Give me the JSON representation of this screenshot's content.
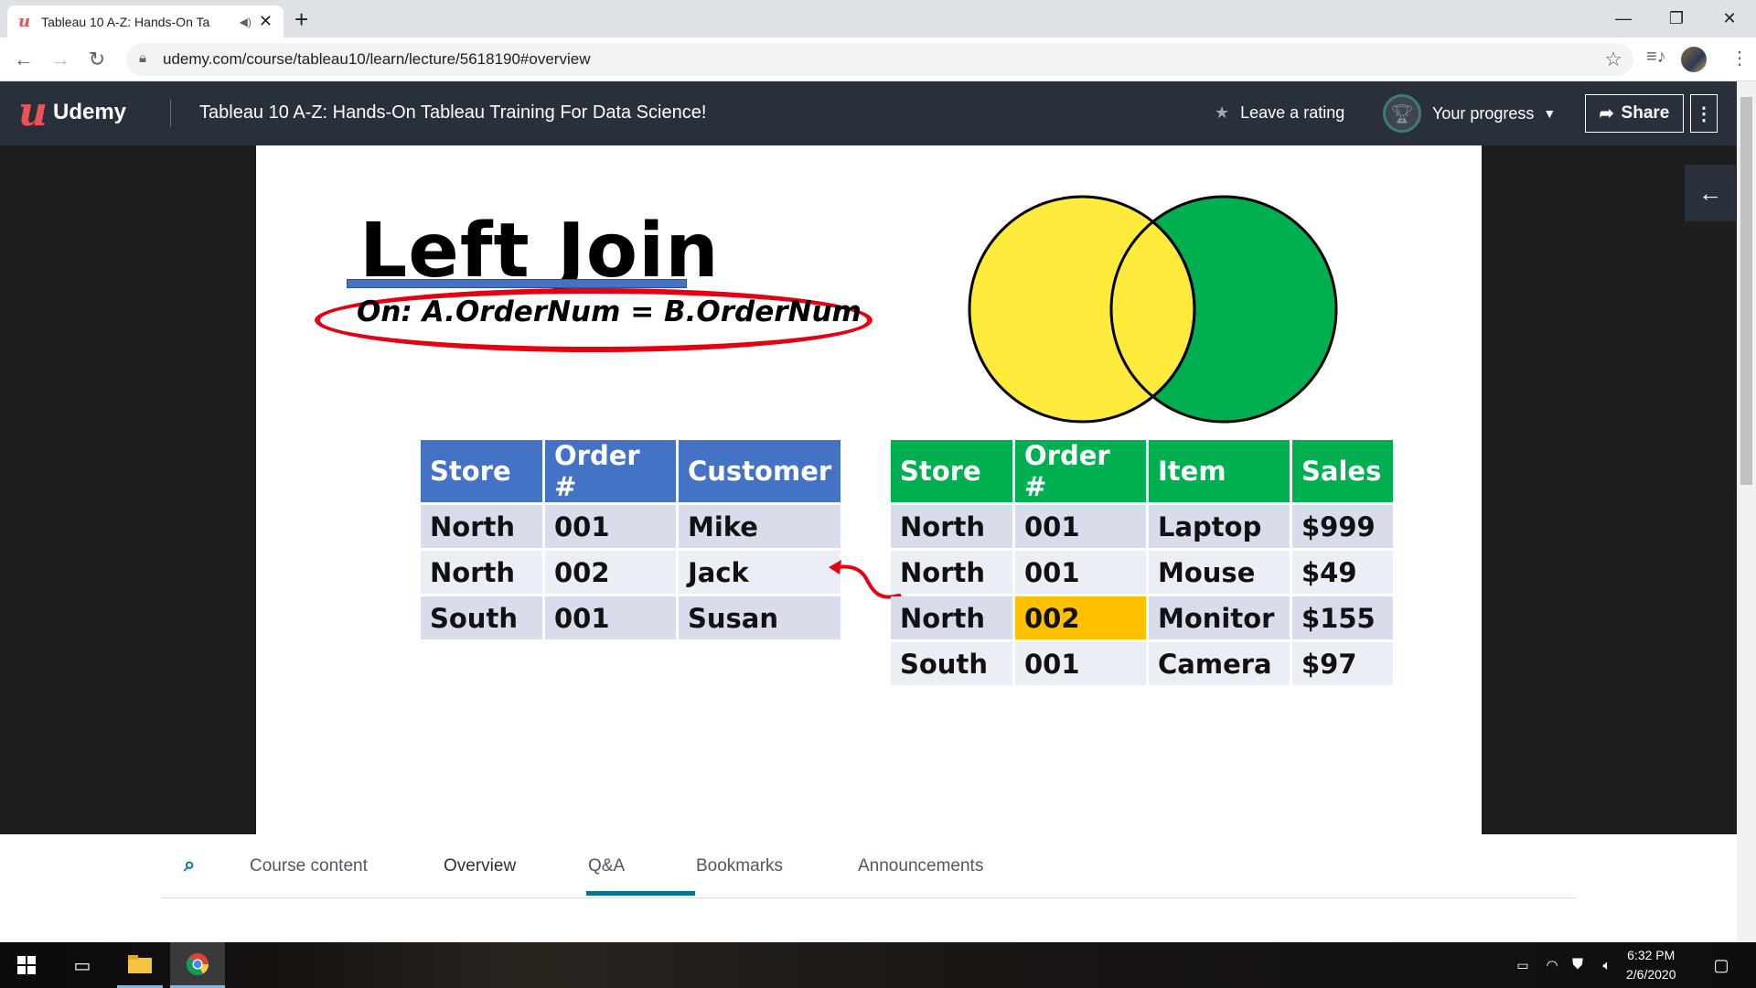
{
  "browser": {
    "tab_title": "Tableau 10 A-Z: Hands-On Ta",
    "tab_favicon": "u",
    "url": "udemy.com/course/tableau10/learn/lecture/5618190#overview"
  },
  "udemy": {
    "brand": "Udemy",
    "course_title": "Tableau 10 A-Z: Hands-On Tableau Training For Data Science!",
    "leave_rating": "Leave a rating",
    "your_progress": "Your progress",
    "share": "Share"
  },
  "slide": {
    "title": "Left Join",
    "condition": "On: A.OrderNum = B.OrderNum",
    "colors": {
      "left_circle": "#ffeb3b",
      "right_circle": "#00b050",
      "highlight": "#ffc000",
      "left_header": "#4472c4",
      "right_header": "#00b050",
      "ellipse": "#e60012"
    },
    "table_a": {
      "headers": [
        "Store",
        "Order #",
        "Customer"
      ],
      "rows": [
        [
          "North",
          "001",
          "Mike"
        ],
        [
          "North",
          "002",
          "Jack"
        ],
        [
          "South",
          "001",
          "Susan"
        ]
      ]
    },
    "table_b": {
      "headers": [
        "Store",
        "Order #",
        "Item",
        "Sales"
      ],
      "rows": [
        [
          "North",
          "001",
          "Laptop",
          "$999"
        ],
        [
          "North",
          "001",
          "Mouse",
          "$49"
        ],
        [
          "North",
          "002",
          "Monitor",
          "$155"
        ],
        [
          "South",
          "001",
          "Camera",
          "$97"
        ]
      ]
    }
  },
  "lecture_tabs": [
    "Course content",
    "Overview",
    "Q&A",
    "Bookmarks",
    "Announcements"
  ],
  "active_tab": "Overview",
  "taskbar": {
    "time": "6:32 PM",
    "date": "2/6/2020"
  }
}
